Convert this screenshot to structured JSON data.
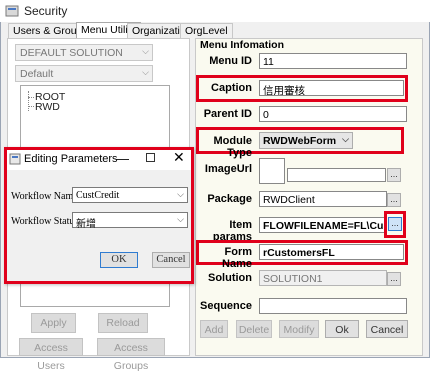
{
  "window": {
    "title": "Security"
  },
  "tabs": [
    "Users & Groups",
    "Menu Utility",
    "Organization",
    "OrgLevel"
  ],
  "left": {
    "solution": "DEFAULT SOLUTION",
    "style": "Default",
    "tree": [
      "ROOT",
      "RWD"
    ],
    "apply": "Apply",
    "reload": "Reload",
    "access_users": "Access Users",
    "access_groups": "Access Groups"
  },
  "dialog": {
    "title": "Editing Parameters",
    "workflow_name_label": "Workflow Name",
    "workflow_name_value": "CustCredit",
    "workflow_status_label": "Workflow Status",
    "workflow_status_value": "新增",
    "ok": "OK",
    "cancel": "Cancel"
  },
  "menu_info": {
    "group_title": "Menu Infomation",
    "menu_id_label": "Menu ID",
    "menu_id": "11",
    "caption_label": "Caption",
    "caption": "信用審核",
    "parent_id_label": "Parent ID",
    "parent_id": "0",
    "module_type_label": "Module Type",
    "module_type": "RWDWebForm",
    "image_url_label": "ImageUrl",
    "package_label": "Package",
    "package": "RWDClient",
    "item_params_label": "Item params",
    "item_params": "FLOWFILENAME=FL\\CustCre",
    "form_name_label": "Form Name",
    "form_name": "rCustomersFL",
    "solution_label": "Solution",
    "solution": "SOLUTION1",
    "sequence_label": "Sequence",
    "sequence": "",
    "add": "Add",
    "delete": "Delete",
    "modify": "Modify",
    "ok": "Ok",
    "cancel": "Cancel",
    "ellipsis": "..."
  },
  "colors": {
    "highlight": "#e0001b",
    "panel_bg": "#fafaf0"
  }
}
